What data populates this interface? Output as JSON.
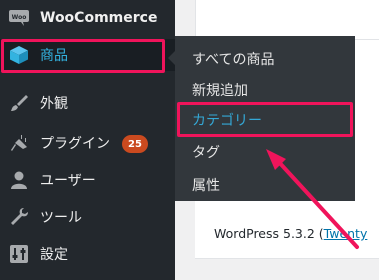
{
  "sidebar": {
    "woocommerce": {
      "label": "WooCommerce",
      "icon": "woo-logo-icon"
    },
    "products": {
      "label": "商品",
      "icon": "cube-icon"
    },
    "appearance": {
      "label": "外観",
      "icon": "paintbrush-icon"
    },
    "plugins": {
      "label": "プラグイン",
      "icon": "plug-icon",
      "badge": "25"
    },
    "users": {
      "label": "ユーザー",
      "icon": "user-icon"
    },
    "tools": {
      "label": "ツール",
      "icon": "wrench-icon"
    },
    "settings": {
      "label": "設定",
      "icon": "sliders-icon"
    }
  },
  "submenu": {
    "all_products": "すべての商品",
    "add_new": "新規追加",
    "categories": "カテゴリー",
    "tags": "タグ",
    "attributes": "属性"
  },
  "content": {
    "wp_version_prefix": "WordPress 5.3.2 (",
    "wp_version_link": "Twenty"
  },
  "colors": {
    "sidebar_bg": "#23282d",
    "submenu_bg": "#32373c",
    "accent": "#33b3e0",
    "highlight": "#f0145b",
    "badge": "#ca4a1f"
  }
}
